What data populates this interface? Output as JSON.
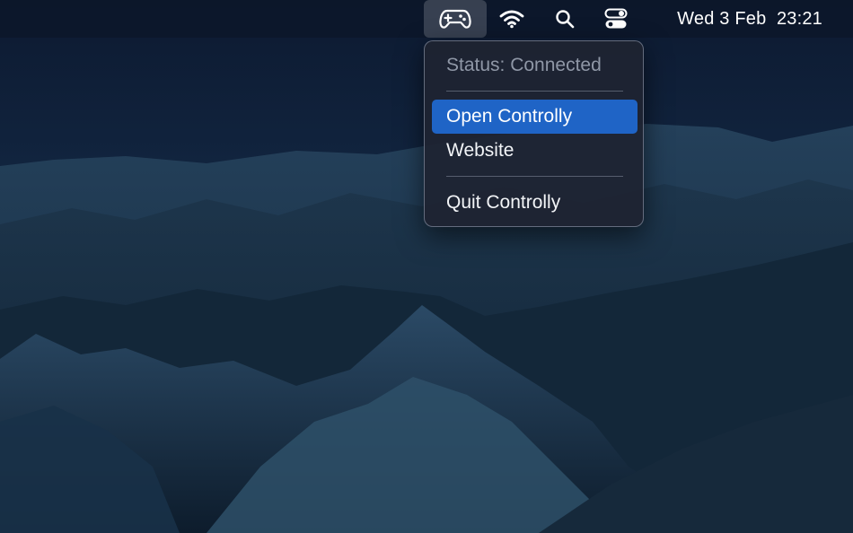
{
  "colors": {
    "menu_highlight": "#1f64c6",
    "menubar_bg": "#0c1628",
    "sky": "#0e1c33",
    "mountains": "#1c3448"
  },
  "menubar": {
    "status_icons": [
      "gamepad-icon",
      "wifi-icon",
      "search-icon",
      "control-center-icon"
    ],
    "clock": "Wed 3 Feb  23:21"
  },
  "menu": {
    "status": "Status: Connected",
    "items": [
      {
        "label": "Open Controlly",
        "highlighted": true
      },
      {
        "label": "Website",
        "highlighted": false
      },
      {
        "label": "Quit Controlly",
        "highlighted": false
      }
    ]
  }
}
